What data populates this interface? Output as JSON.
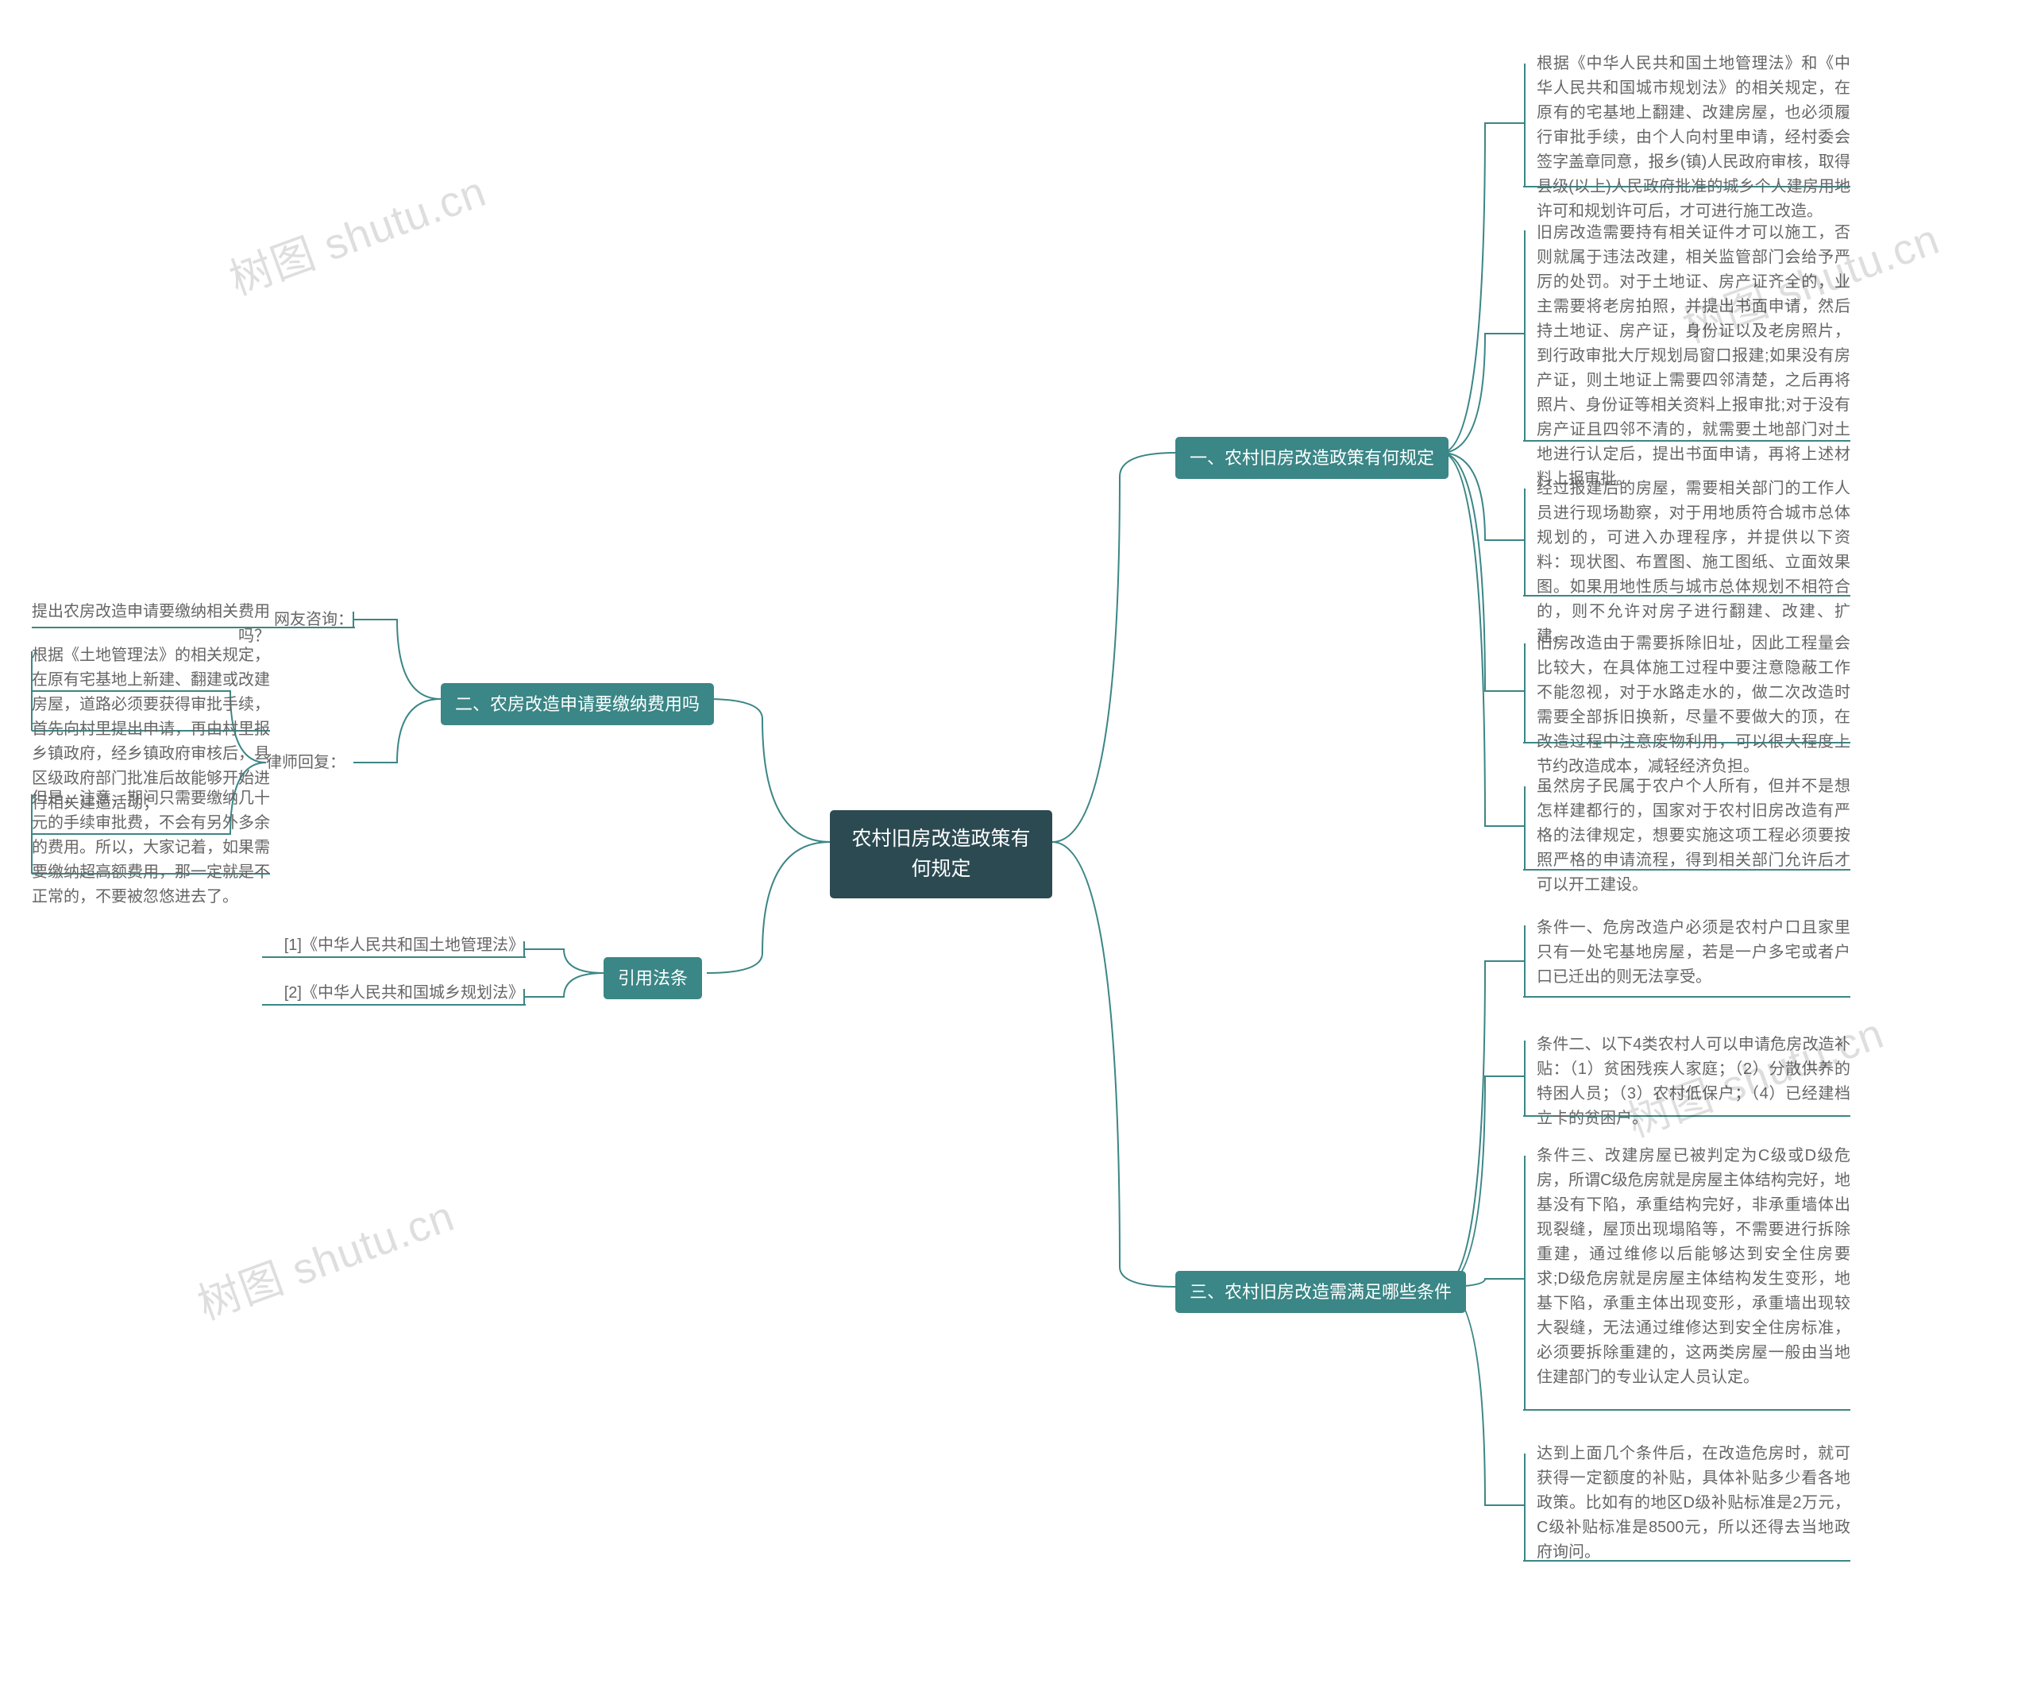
{
  "watermark": "树图 shutu.cn",
  "root": "农村旧房改造政策有何规定",
  "branches": {
    "b1": {
      "title": "一、农村旧房改造政策有何规定",
      "leaves": [
        "根据《中华人民共和国土地管理法》和《中华人民共和国城市规划法》的相关规定，在原有的宅基地上翻建、改建房屋，也必须履行审批手续，由个人向村里申请，经村委会签字盖章同意，报乡(镇)人民政府审核，取得县级(以上)人民政府批准的城乡个人建房用地许可和规划许可后，才可进行施工改造。",
        "旧房改造需要持有相关证件才可以施工，否则就属于违法改建，相关监管部门会给予严厉的处罚。对于土地证、房产证齐全的，业主需要将老房拍照，并提出书面申请，然后持土地证、房产证，身份证以及老房照片，到行政审批大厅规划局窗口报建;如果没有房产证，则土地证上需要四邻清楚，之后再将照片、身份证等相关资料上报审批;对于没有房产证且四邻不清的，就需要土地部门对土地进行认定后，提出书面申请，再将上述材料上报审批。",
        "经过报建后的房屋，需要相关部门的工作人员进行现场勘察，对于用地质符合城市总体规划的，可进入办理程序，并提供以下资料：现状图、布置图、施工图纸、立面效果图。如果用地性质与城市总体规划不相符合的，则不允许对房子进行翻建、改建、扩建。",
        "旧房改造由于需要拆除旧址，因此工程量会比较大，在具体施工过程中要注意隐蔽工作不能忽视，对于水路走水的，做二次改造时需要全部拆旧换新，尽量不要做大的顶，在改造过程中注意废物利用，可以很大程度上节约改造成本，减轻经济负担。",
        "虽然房子民属于农户个人所有，但并不是想怎样建都行的，国家对于农村旧房改造有严格的法律规定，想要实施这项工程必须要按照严格的申请流程，得到相关部门允许后才可以开工建设。"
      ]
    },
    "b2": {
      "title": "二、农房改造申请要缴纳费用吗",
      "sub1": {
        "label": "网友咨询：",
        "text": "提出农房改造申请要缴纳相关费用吗？"
      },
      "sub2": {
        "label": "律师回复：",
        "text1": "根据《土地管理法》的相关规定，在原有宅基地上新建、翻建或改建房屋，道路必须要获得审批手续，首先向村里提出申请，再由村里报乡镇政府，经乡镇政府审核后，县区级政府部门批准后故能够开始进行相关建造活动；",
        "text2": "但是，注意，期间只需要缴纳几十元的手续审批费，不会有另外多余的费用。所以，大家记着，如果需要缴纳超高额费用，那一定就是不正常的，不要被忽悠进去了。"
      }
    },
    "b3": {
      "title": "三、农村旧房改造需满足哪些条件",
      "leaves": [
        "条件一、危房改造户必须是农村户口且家里只有一处宅基地房屋，若是一户多宅或者户口已迁出的则无法享受。",
        "条件二、以下4类农村人可以申请危房改造补贴：（1）贫困残疾人家庭；（2）分散供养的特困人员；（3）农村低保户；（4）已经建档立卡的贫困户。",
        "条件三、改建房屋已被判定为C级或D级危房，所谓C级危房就是房屋主体结构完好，地基没有下陷，承重结构完好，非承重墙体出现裂缝，屋顶出现塌陷等，不需要进行拆除重建，通过维修以后能够达到安全住房要求;D级危房就是房屋主体结构发生变形，地基下陷，承重主体出现变形，承重墙出现较大裂缝，无法通过维修达到安全住房标准，必须要拆除重建的，这两类房屋一般由当地住建部门的专业认定人员认定。",
        "达到上面几个条件后，在改造危房时，就可获得一定额度的补贴，具体补贴多少看各地政策。比如有的地区D级补贴标准是2万元，C级补贴标准是8500元，所以还得去当地政府询问。"
      ]
    },
    "b4": {
      "title": "引用法条",
      "leaves": [
        "[1]《中华人民共和国土地管理法》",
        "[2]《中华人民共和国城乡规划法》"
      ]
    }
  },
  "colors": {
    "root_bg": "#2c4a52",
    "branch_bg": "#3b8686",
    "leaf_text": "#666666",
    "connector": "#3b8686"
  }
}
